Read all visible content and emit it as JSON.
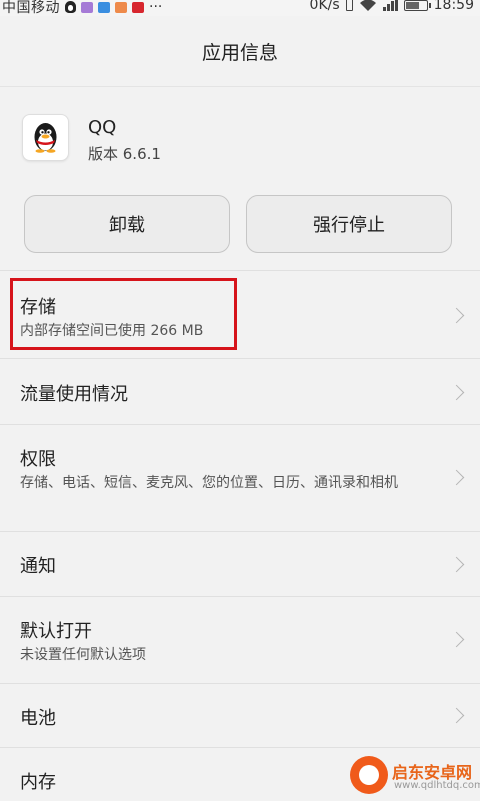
{
  "status_bar": {
    "carrier": "中国移动",
    "ellipsis": "···",
    "net_speed": "0K/s",
    "time": "18:59",
    "icons": [
      "qq-icon",
      "app-icon-purple",
      "app-icon-blue",
      "app-icon-orange",
      "huawei-icon",
      "vibrate-icon",
      "wifi-icon",
      "signal-icon",
      "battery-icon"
    ]
  },
  "header": {
    "title": "应用信息"
  },
  "app": {
    "name": "QQ",
    "version": "版本 6.6.1",
    "icon": "qq-penguin-icon"
  },
  "buttons": {
    "uninstall": "卸载",
    "force_stop": "强行停止"
  },
  "rows": [
    {
      "title": "存储",
      "sub": "内部存储空间已使用 266 MB"
    },
    {
      "title": "流量使用情况"
    },
    {
      "title": "权限",
      "sub": "存储、电话、短信、麦克风、您的位置、日历、通讯录和相机"
    },
    {
      "title": "通知"
    },
    {
      "title": "默认打开",
      "sub": "未设置任何默认选项"
    },
    {
      "title": "电池"
    },
    {
      "title": "内存"
    }
  ],
  "watermark": {
    "text": "启东安卓网",
    "url": "www.qdlhtdq.com"
  },
  "colors": {
    "highlight": "#d6141b",
    "background": "#f2f2f2"
  }
}
